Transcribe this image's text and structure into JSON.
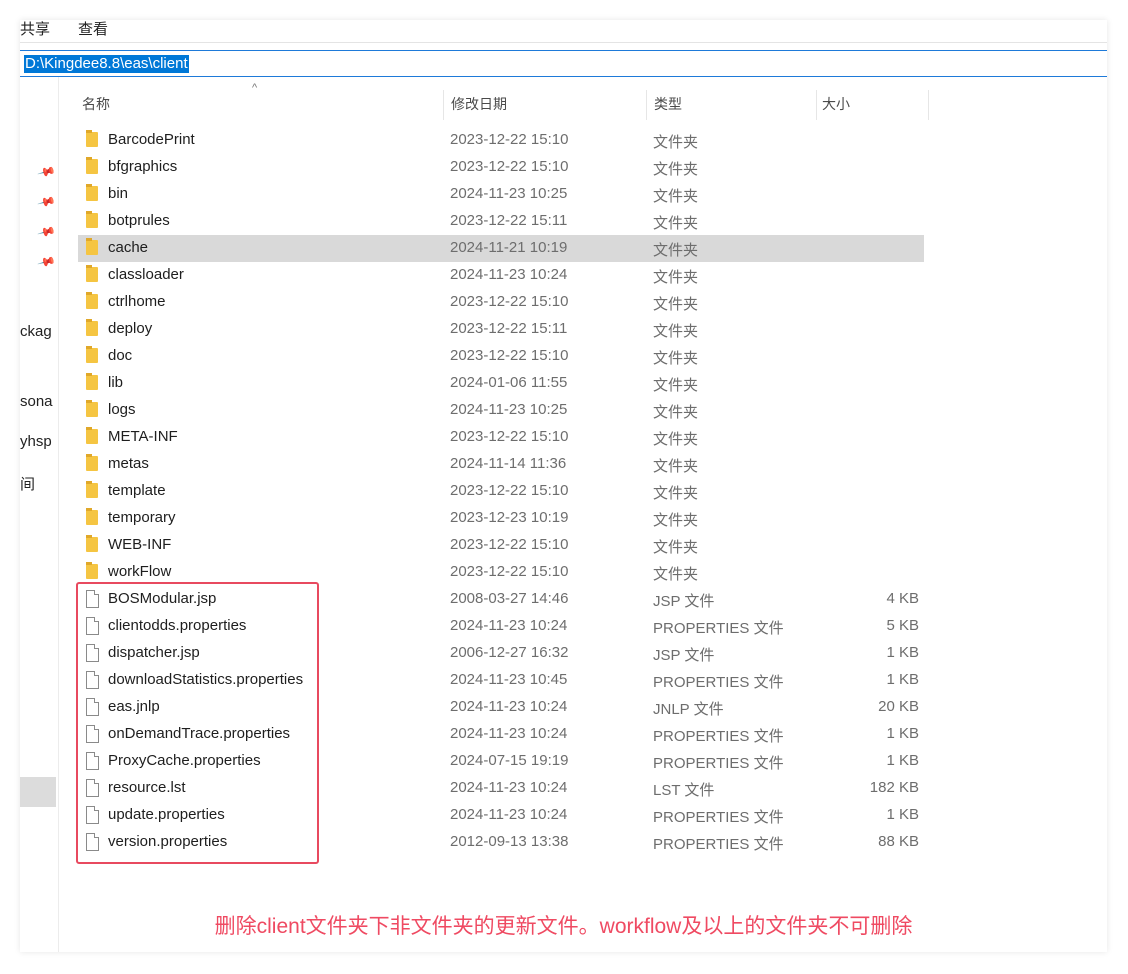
{
  "ribbon": {
    "tab_share": "共享",
    "tab_view": "查看"
  },
  "address_bar": {
    "path": "D:\\Kingdee8.8\\eas\\client"
  },
  "nav_pane": {
    "items": [
      "ckag",
      "sona",
      "yhsp",
      "间"
    ]
  },
  "columns": {
    "name": "名称",
    "date": "修改日期",
    "type": "类型",
    "size": "大小"
  },
  "rows": [
    {
      "name": "BarcodePrint",
      "date": "2023-12-22 15:10",
      "type": "文件夹",
      "size": "",
      "kind": "folder"
    },
    {
      "name": "bfgraphics",
      "date": "2023-12-22 15:10",
      "type": "文件夹",
      "size": "",
      "kind": "folder"
    },
    {
      "name": "bin",
      "date": "2024-11-23 10:25",
      "type": "文件夹",
      "size": "",
      "kind": "folder"
    },
    {
      "name": "botprules",
      "date": "2023-12-22 15:11",
      "type": "文件夹",
      "size": "",
      "kind": "folder"
    },
    {
      "name": "cache",
      "date": "2024-11-21 10:19",
      "type": "文件夹",
      "size": "",
      "kind": "folder",
      "selected": true
    },
    {
      "name": "classloader",
      "date": "2024-11-23 10:24",
      "type": "文件夹",
      "size": "",
      "kind": "folder"
    },
    {
      "name": "ctrlhome",
      "date": "2023-12-22 15:10",
      "type": "文件夹",
      "size": "",
      "kind": "folder"
    },
    {
      "name": "deploy",
      "date": "2023-12-22 15:11",
      "type": "文件夹",
      "size": "",
      "kind": "folder"
    },
    {
      "name": "doc",
      "date": "2023-12-22 15:10",
      "type": "文件夹",
      "size": "",
      "kind": "folder"
    },
    {
      "name": "lib",
      "date": "2024-01-06 11:55",
      "type": "文件夹",
      "size": "",
      "kind": "folder"
    },
    {
      "name": "logs",
      "date": "2024-11-23 10:25",
      "type": "文件夹",
      "size": "",
      "kind": "folder"
    },
    {
      "name": "META-INF",
      "date": "2023-12-22 15:10",
      "type": "文件夹",
      "size": "",
      "kind": "folder"
    },
    {
      "name": "metas",
      "date": "2024-11-14 11:36",
      "type": "文件夹",
      "size": "",
      "kind": "folder"
    },
    {
      "name": "template",
      "date": "2023-12-22 15:10",
      "type": "文件夹",
      "size": "",
      "kind": "folder"
    },
    {
      "name": "temporary",
      "date": "2023-12-23 10:19",
      "type": "文件夹",
      "size": "",
      "kind": "folder"
    },
    {
      "name": "WEB-INF",
      "date": "2023-12-22 15:10",
      "type": "文件夹",
      "size": "",
      "kind": "folder"
    },
    {
      "name": "workFlow",
      "date": "2023-12-22 15:10",
      "type": "文件夹",
      "size": "",
      "kind": "folder"
    },
    {
      "name": "BOSModular.jsp",
      "date": "2008-03-27 14:46",
      "type": "JSP 文件",
      "size": "4 KB",
      "kind": "file"
    },
    {
      "name": "clientodds.properties",
      "date": "2024-11-23 10:24",
      "type": "PROPERTIES 文件",
      "size": "5 KB",
      "kind": "file"
    },
    {
      "name": "dispatcher.jsp",
      "date": "2006-12-27 16:32",
      "type": "JSP 文件",
      "size": "1 KB",
      "kind": "file"
    },
    {
      "name": "downloadStatistics.properties",
      "date": "2024-11-23 10:45",
      "type": "PROPERTIES 文件",
      "size": "1 KB",
      "kind": "file"
    },
    {
      "name": "eas.jnlp",
      "date": "2024-11-23 10:24",
      "type": "JNLP 文件",
      "size": "20 KB",
      "kind": "file"
    },
    {
      "name": "onDemandTrace.properties",
      "date": "2024-11-23 10:24",
      "type": "PROPERTIES 文件",
      "size": "1 KB",
      "kind": "file"
    },
    {
      "name": "ProxyCache.properties",
      "date": "2024-07-15 19:19",
      "type": "PROPERTIES 文件",
      "size": "1 KB",
      "kind": "file"
    },
    {
      "name": "resource.lst",
      "date": "2024-11-23 10:24",
      "type": "LST 文件",
      "size": "182 KB",
      "kind": "file"
    },
    {
      "name": "update.properties",
      "date": "2024-11-23 10:24",
      "type": "PROPERTIES 文件",
      "size": "1 KB",
      "kind": "file"
    },
    {
      "name": "version.properties",
      "date": "2012-09-13 13:38",
      "type": "PROPERTIES 文件",
      "size": "88 KB",
      "kind": "file"
    }
  ],
  "annotation": "删除client文件夹下非文件夹的更新文件。workflow及以上的文件夹不可删除",
  "colors": {
    "highlight_box": "#e84a5f",
    "annotation_text": "#ef4a62",
    "selection": "#0078d7"
  }
}
